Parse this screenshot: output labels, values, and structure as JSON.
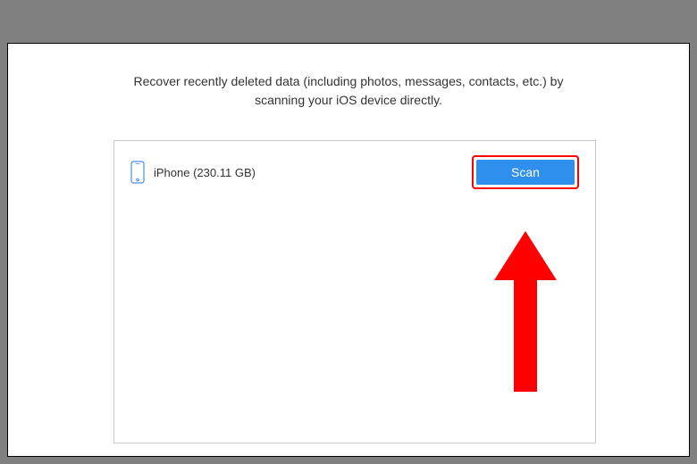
{
  "description": {
    "line1": "Recover recently deleted data (including photos, messages, contacts, etc.) by",
    "line2": "scanning your iOS device directly."
  },
  "device": {
    "name": "iPhone (230.11 GB)"
  },
  "actions": {
    "scan_label": "Scan"
  },
  "colors": {
    "accent_blue": "#2f8fed",
    "highlight_red": "#ff0000"
  }
}
